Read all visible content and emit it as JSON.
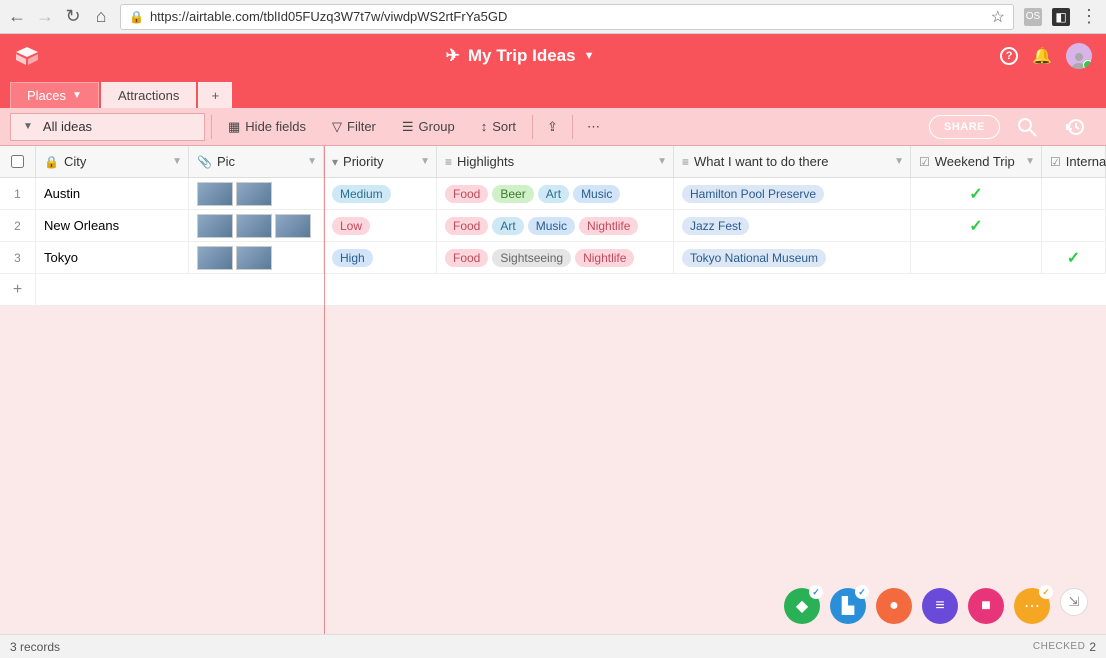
{
  "browser": {
    "url": "https://airtable.com/tblId05FUzq3W7t7w/viwdpWS2rtFrYa5GD"
  },
  "header": {
    "title": "My Trip Ideas"
  },
  "tabs": [
    {
      "label": "Places",
      "active": true
    },
    {
      "label": "Attractions",
      "active": false
    }
  ],
  "toolbar": {
    "view_label": "All ideas",
    "hide_fields": "Hide fields",
    "filter": "Filter",
    "group": "Group",
    "sort": "Sort",
    "share": "SHARE"
  },
  "columns": {
    "city": "City",
    "pic": "Pic",
    "priority": "Priority",
    "highlights": "Highlights",
    "want": "What I want to do there",
    "weekend": "Weekend Trip",
    "international": "Interna"
  },
  "rows": [
    {
      "n": "1",
      "city": "Austin",
      "pics": 2,
      "priority": {
        "label": "Medium",
        "cls": "p-med"
      },
      "highlights": [
        {
          "label": "Food",
          "cls": "p-food"
        },
        {
          "label": "Beer",
          "cls": "p-beer"
        },
        {
          "label": "Art",
          "cls": "p-art"
        },
        {
          "label": "Music",
          "cls": "p-music"
        }
      ],
      "want": "Hamilton Pool Preserve",
      "weekend": true,
      "international": false
    },
    {
      "n": "2",
      "city": "New Orleans",
      "pics": 3,
      "priority": {
        "label": "Low",
        "cls": "p-low"
      },
      "highlights": [
        {
          "label": "Food",
          "cls": "p-food"
        },
        {
          "label": "Art",
          "cls": "p-art"
        },
        {
          "label": "Music",
          "cls": "p-music"
        },
        {
          "label": "Nightlife",
          "cls": "p-night"
        }
      ],
      "want": "Jazz Fest",
      "weekend": true,
      "international": false
    },
    {
      "n": "3",
      "city": "Tokyo",
      "pics": 2,
      "priority": {
        "label": "High",
        "cls": "p-high"
      },
      "highlights": [
        {
          "label": "Food",
          "cls": "p-food"
        },
        {
          "label": "Sightseeing",
          "cls": "p-sight"
        },
        {
          "label": "Nightlife",
          "cls": "p-night"
        }
      ],
      "want": "Tokyo National Museum",
      "weekend": false,
      "international": true
    }
  ],
  "fabs": [
    {
      "color": "#2bb155",
      "glyph": "◆",
      "badge": "blue"
    },
    {
      "color": "#2a8fd8",
      "glyph": "▙",
      "badge": "blue"
    },
    {
      "color": "#f26a3e",
      "glyph": "●",
      "badge": null
    },
    {
      "color": "#6a4ad8",
      "glyph": "≡",
      "badge": null
    },
    {
      "color": "#e8357a",
      "glyph": "■",
      "badge": null
    },
    {
      "color": "#f5a623",
      "glyph": "⋯",
      "badge": "orange"
    }
  ],
  "status": {
    "records": "3 records",
    "checked_label": "CHECKED",
    "checked_count": "2"
  }
}
